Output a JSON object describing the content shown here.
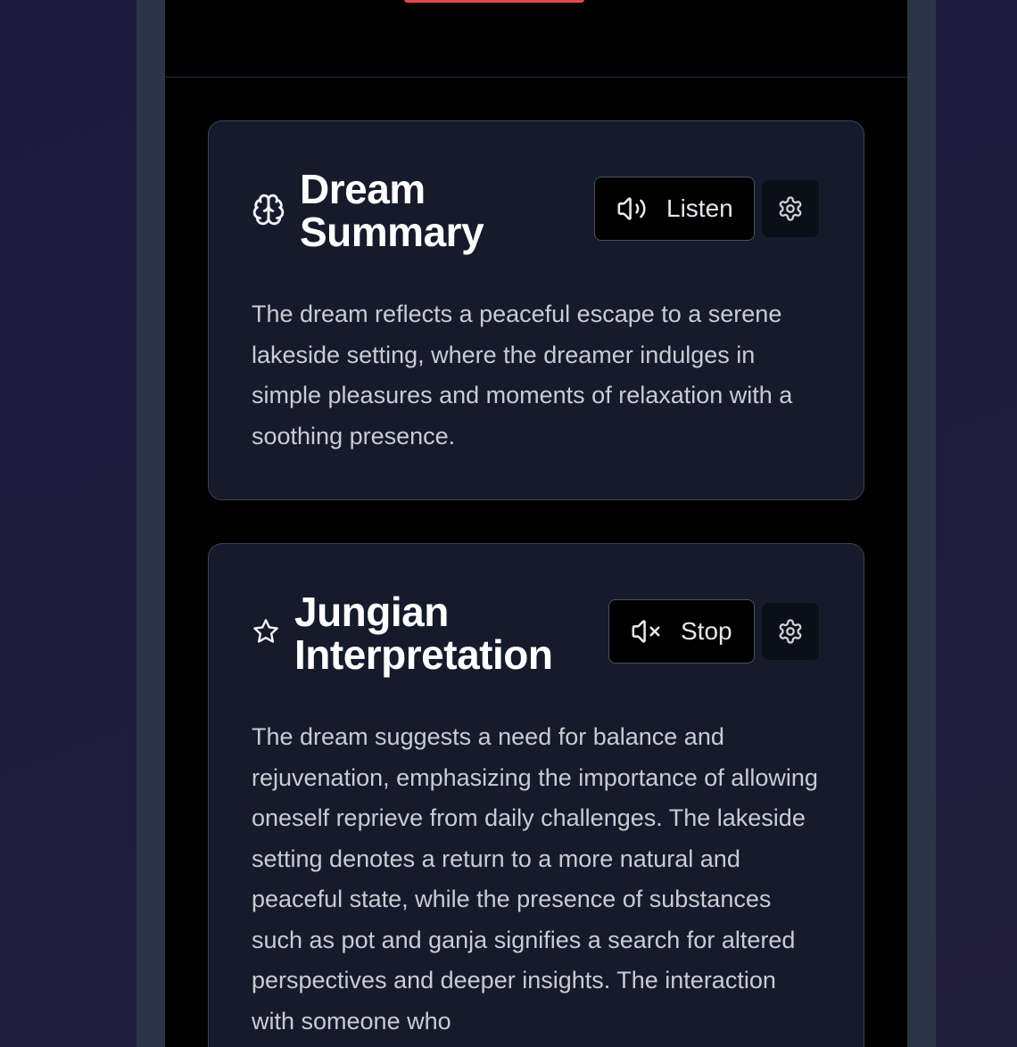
{
  "cards": [
    {
      "icon": "brain-icon",
      "title_line1": "Dream",
      "title_line2": "Summary",
      "audio_button_label": "Listen",
      "audio_icon": "speaker-icon",
      "settings_icon": "gear-icon",
      "body": "The dream reflects a peaceful escape to a serene lakeside setting, where the dreamer indulges in simple pleasures and moments of relaxation with a soothing presence."
    },
    {
      "icon": "star-icon",
      "title_line1": "Jungian",
      "title_line2": "Interpretation",
      "audio_button_label": "Stop",
      "audio_icon": "speaker-muted-icon",
      "settings_icon": "gear-icon",
      "body": "The dream suggests a need for balance and rejuvenation, emphasizing the importance of allowing oneself reprieve from daily challenges. The lakeside setting denotes a return to a more natural and peaceful state, while the presence of substances such as pot and ganja signifies a search for altered perspectives and deeper insights. The interaction with someone who"
    }
  ],
  "colors": {
    "accent": "#e5484d",
    "card_background": "#151b2a",
    "app_background": "#000000"
  }
}
